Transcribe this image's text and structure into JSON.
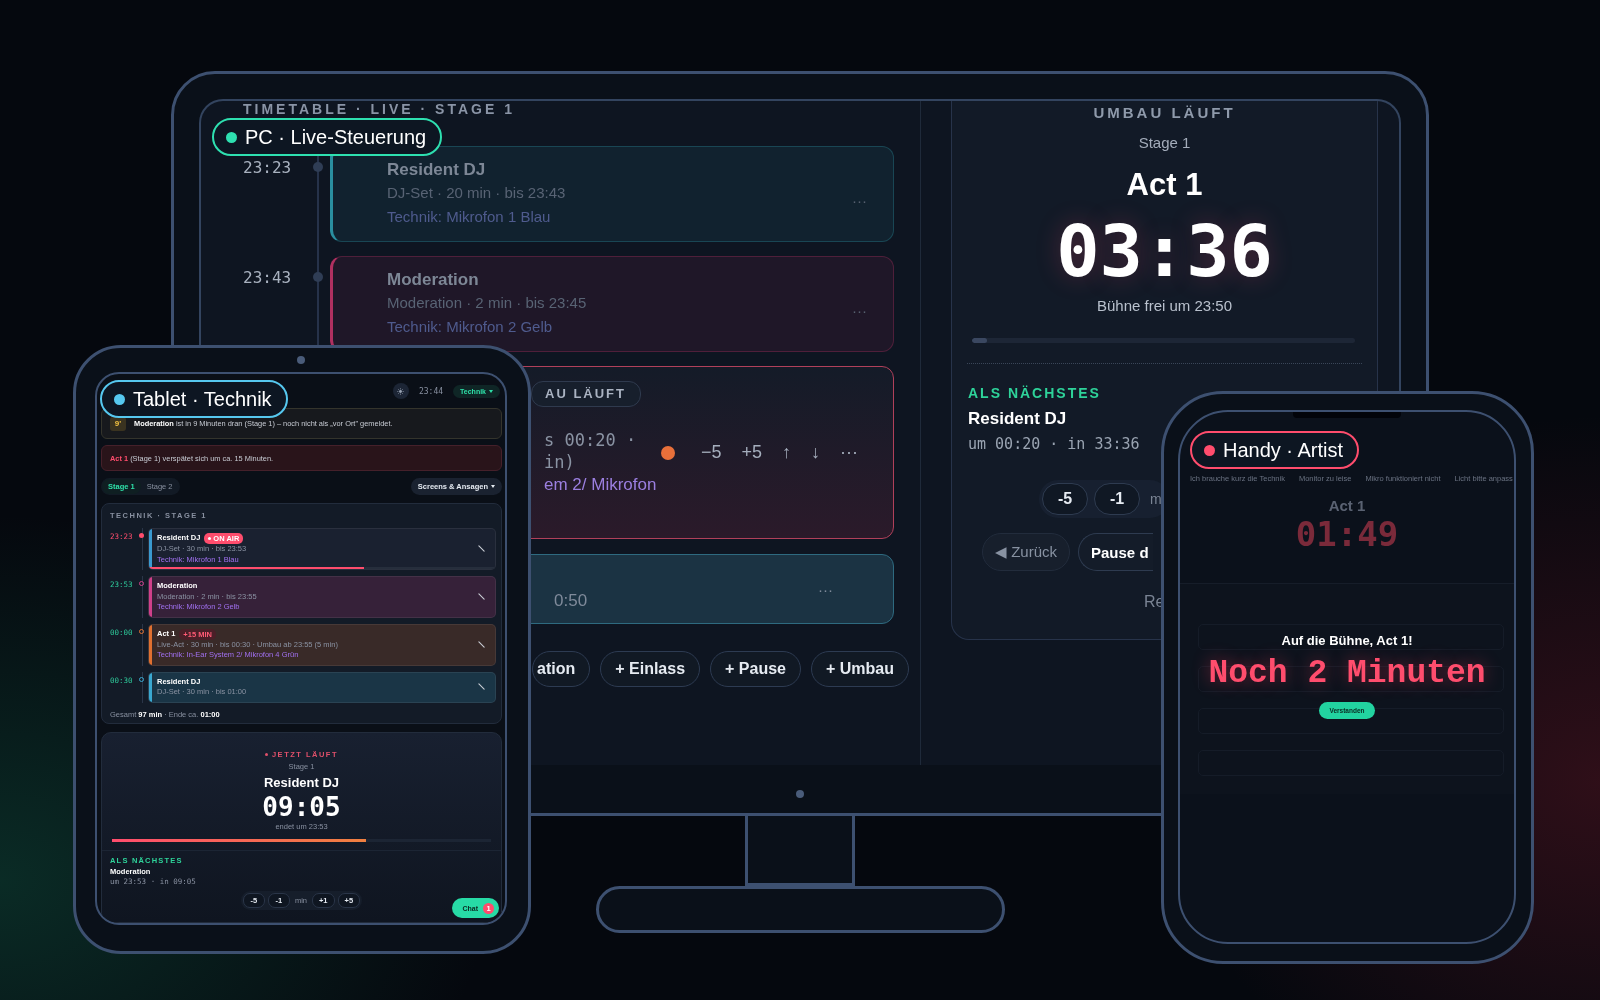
{
  "labels": [
    {
      "text": "PC · Live-Steuerung",
      "color": "#2ee0b0"
    },
    {
      "text": "Tablet · Technik",
      "color": "#56c8ef"
    },
    {
      "text": "Handy · Artist",
      "color": "#ff4d6d"
    }
  ],
  "pc": {
    "timetable": {
      "title": "TIMETABLE · LIVE · STAGE 1",
      "rows": [
        {
          "time": "23:23",
          "title": "Resident DJ",
          "meta": "DJ-Set · 20 min · bis 23:43",
          "tech": "Technik: Mikrofon 1 Blau",
          "menu": "···",
          "color": "#2a8fa0"
        },
        {
          "time": "23:43",
          "title": "Moderation",
          "meta": "Moderation · 2 min · bis 23:45",
          "tech": "Technik: Mikrofon 2 Gelb",
          "menu": "···",
          "color": "#b03060"
        }
      ],
      "live_card": {
        "badge": "AU LÄUFT",
        "lines": [
          "s 00:20 ·",
          "in)"
        ],
        "tech": "em 2/ Mikrofon",
        "controls": [
          "−5",
          "+5",
          "↑",
          "↓",
          "···"
        ]
      },
      "next_card": {
        "time": "0:50",
        "menu": "···"
      },
      "add_buttons": [
        "ation",
        "+ Einlass",
        "+ Pause",
        "+ Umbau"
      ]
    },
    "stage_display": {
      "status": "UMBAU LÄUFT",
      "stage": "Stage 1",
      "act": "Act 1",
      "countdown": "03:36",
      "subtitle": "Bühne frei um 23:50",
      "progress": {
        "level": 0.04
      },
      "next_label": "ALS NÄCHSTES",
      "next_title": "Resident DJ",
      "next_time": "um 00:20 · in 33:36",
      "steppers": [
        "-5",
        "-1"
      ],
      "stepper_unit": "m",
      "buttons": [
        {
          "label": "◀ Zurück",
          "kind": "secondary"
        },
        {
          "label": "Pause d",
          "kind": "primary"
        }
      ],
      "footer": "Re"
    }
  },
  "tablet": {
    "clock": "23:44",
    "role": "Technik",
    "alerts": [
      {
        "kind": "warning",
        "badge": "9'",
        "highlight": "Moderation",
        "text": "ist in 9 Minuten dran (Stage 1) – noch nicht als „vor Ort\" gemeldet."
      },
      {
        "kind": "error",
        "highlight": "Act 1",
        "text": "(Stage 1) verspätet sich um ca. 15 Minuten."
      }
    ],
    "tabs": [
      {
        "label": "Stage 1",
        "selected": true
      },
      {
        "label": "Stage 2",
        "selected": false
      }
    ],
    "menu_button": "Screens & Ansagen",
    "panel": {
      "title": "TECHNIK · STAGE 1",
      "rows": [
        {
          "time": "23:23",
          "kind": "live",
          "title": "Resident DJ",
          "badge": {
            "text": "ON AIR",
            "kind": "live"
          },
          "meta": "DJ-Set · 30 min · bis 23:53",
          "tech": "Technik: Mikrofon 1 Blau",
          "color": "#3a9ad0",
          "level": 0.62
        },
        {
          "time": "23:53",
          "kind": "planned",
          "title": "Moderation",
          "meta": "Moderation · 2 min · bis 23:55",
          "tech": "Technik: Mikrofon 2 Gelb",
          "color": "#d0408a"
        },
        {
          "time": "00:00",
          "kind": "planned",
          "title": "Act 1",
          "badge": {
            "text": "+15 MIN",
            "kind": "late"
          },
          "meta": "Live-Act · 30 min · bis 00:30 · Umbau ab 23:55 (5 min)",
          "tech": "Technik: In-Ear System 2/ Mikrofon 4 Grün",
          "color": "#e07030"
        },
        {
          "time": "00:30",
          "kind": "planned",
          "title": "Resident DJ",
          "meta": "DJ-Set · 30 min · bis 01:00",
          "color": "#3aa8d0"
        }
      ],
      "total": "Gesamt **97 min** · Ende ca. **01:00**"
    },
    "now": {
      "status": "JETZT LÄUFT",
      "stage": "Stage 1",
      "title": "Resident DJ",
      "countdown": "09:05",
      "subtitle": "endet um 23:53",
      "progress": {
        "level": 0.67
      },
      "next_label": "ALS NÄCHSTES",
      "next_title": "Moderation",
      "next_time": "um 23:53 · in 09:05",
      "steppers": [
        {
          "label": "-5",
          "kind": "button"
        },
        {
          "label": "-1",
          "kind": "button"
        },
        {
          "label": "min",
          "kind": "unit"
        },
        {
          "label": "+1",
          "kind": "button"
        },
        {
          "label": "+5",
          "kind": "button"
        }
      ]
    },
    "chat": {
      "label": "Chat",
      "count": "1"
    }
  },
  "phone": {
    "quick_messages": [
      "Ich brauche kurz die Technik",
      "Monitor zu leise",
      "Mikro funktioniert nicht",
      "Licht bitte anpass"
    ],
    "act": "Act 1",
    "countdown": "01:49",
    "alert": {
      "title": "Auf die Bühne, Act 1!",
      "message": "Noch 2 Minuten",
      "button": "Verstanden"
    }
  }
}
